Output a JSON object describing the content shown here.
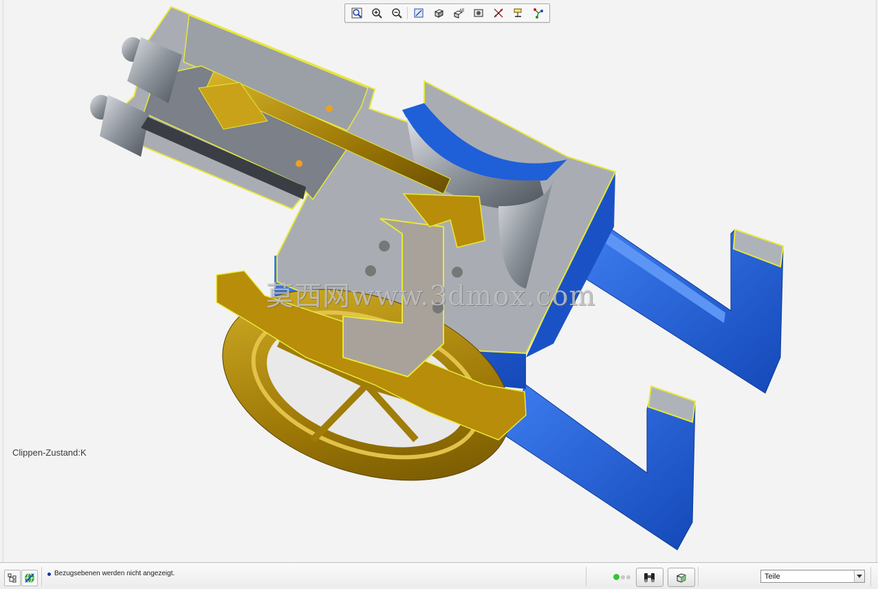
{
  "viewport": {
    "clipping_state": "Clippen-Zustand:K",
    "watermark": "莫西网www.3dmox.com"
  },
  "toolbar": {
    "buttons": [
      {
        "icon": "zoom-fit-icon"
      },
      {
        "icon": "zoom-in-icon"
      },
      {
        "icon": "zoom-out-icon"
      },
      {
        "icon": "repaint-icon"
      },
      {
        "icon": "display-style-icon"
      },
      {
        "icon": "saved-views-icon"
      },
      {
        "icon": "view-manager-icon"
      },
      {
        "icon": "datum-display-icon"
      },
      {
        "icon": "annotation-display-icon"
      },
      {
        "icon": "spin-center-icon"
      }
    ]
  },
  "statusbar": {
    "message": "Bezugsebenen werden nicht angezeigt.",
    "filter_value": "Teile",
    "colors": {
      "bulb_on": "#35c635",
      "bulb_off": "#c8c8c8",
      "message_dot": "#1b2e9e"
    }
  },
  "colors": {
    "section_face": "#a9adb3",
    "section_edge": "#e8e83a",
    "blue_part": "#1f5fd8",
    "gold_part": "#b78d0a",
    "steel": "#8e949c"
  }
}
